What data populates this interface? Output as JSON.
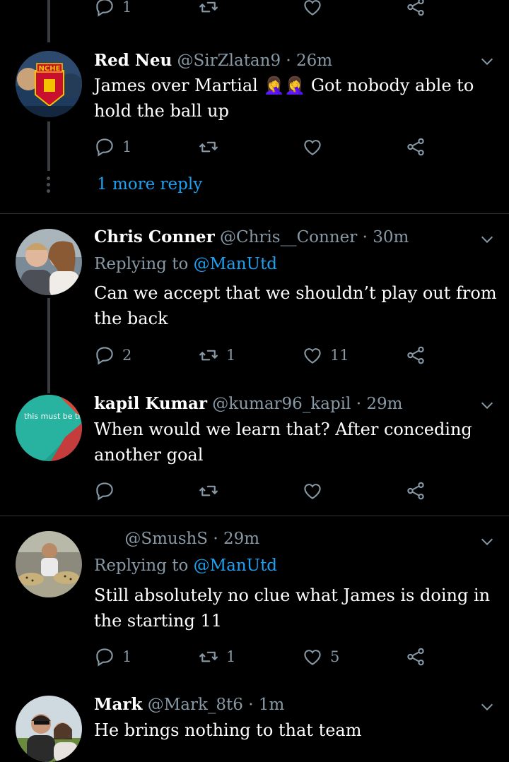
{
  "top_actions": {
    "reply_count": "1"
  },
  "tweets": [
    {
      "name": "Red Neu",
      "handle": "@SirZlatan9",
      "time": "26m",
      "text": "James over Martial 🤦‍♀️🤦‍♀️ Got nobody able to hold the ball up",
      "reply_count": "1",
      "retweet_count": "",
      "like_count": "",
      "more_replies": "1 more reply"
    },
    {
      "name": "Chris Conner",
      "handle": "@Chris__Conner",
      "time": "30m",
      "replying_label": "Replying to",
      "replying_handle": "@ManUtd",
      "text": "Can we accept that we shouldn’t play out from the back",
      "reply_count": "2",
      "retweet_count": "1",
      "like_count": "11"
    },
    {
      "name": "kapil Kumar",
      "handle": "@kumar96_kapil",
      "time": "29m",
      "avatar_text": "this must be the place",
      "text": "When would we learn that? After conceding another goal",
      "reply_count": "",
      "retweet_count": "",
      "like_count": ""
    },
    {
      "name": "",
      "handle": "@SmushS",
      "time": "29m",
      "replying_label": "Replying to",
      "replying_handle": "@ManUtd",
      "text": "Still absolutely no clue what James is doing in the starting 11",
      "reply_count": "1",
      "retweet_count": "1",
      "like_count": "5"
    },
    {
      "name": "Mark",
      "handle": "@Mark_8t6",
      "time": "1m",
      "text": "He brings nothing to that team"
    }
  ],
  "dot_separator": "·",
  "colors": {
    "background": "#000000",
    "muted": "#8899a6",
    "link": "#1da1f2",
    "divider": "#2f3336"
  },
  "icons": [
    "reply-icon",
    "retweet-icon",
    "like-icon",
    "share-icon",
    "chevron-down-icon"
  ]
}
